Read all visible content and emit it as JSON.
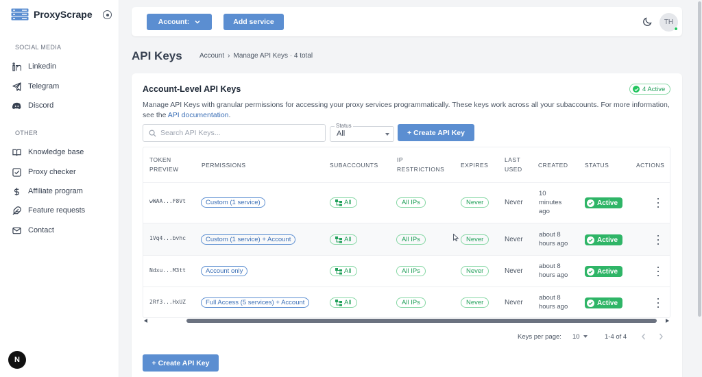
{
  "brand": {
    "name": "ProxyScrape",
    "logo_icon": "server-stack-icon",
    "accent": "#5b8ed1"
  },
  "sidebar": {
    "social_title": "SOCIAL MEDIA",
    "social": [
      {
        "label": "Linkedin",
        "icon": "linkedin-icon"
      },
      {
        "label": "Telegram",
        "icon": "telegram-icon"
      },
      {
        "label": "Discord",
        "icon": "discord-icon"
      }
    ],
    "other_title": "OTHER",
    "other": [
      {
        "label": "Knowledge base",
        "icon": "book-icon"
      },
      {
        "label": "Proxy checker",
        "icon": "checkbox-icon"
      },
      {
        "label": "Affiliate program",
        "icon": "dollar-icon"
      },
      {
        "label": "Feature requests",
        "icon": "feather-icon"
      },
      {
        "label": "Contact",
        "icon": "mail-icon"
      }
    ],
    "n_badge": "N"
  },
  "topbar": {
    "account_label": "Account:",
    "add_service_label": "Add service",
    "avatar_initials": "TH",
    "avatar_status_color": "#22c55e"
  },
  "header": {
    "title": "API Keys",
    "breadcrumb_root": "Account",
    "breadcrumb_current": "Manage API Keys · 4 total"
  },
  "card": {
    "title": "Account-Level API Keys",
    "active_badge": "4 Active",
    "description": "Manage API Keys with granular permissions for accessing your proxy services programmatically. These keys work across all your subaccounts. For more information, see the",
    "doc_link": "API documentation",
    "doc_suffix": ".",
    "search_placeholder": "Search API Keys...",
    "status_legend": "Status",
    "status_value": "All",
    "create_label": "+ Create API Key"
  },
  "table": {
    "headers": {
      "token": [
        "TOKEN",
        "PREVIEW"
      ],
      "permissions": "PERMISSIONS",
      "subaccounts": "SUBACCOUNTS",
      "ip": [
        "IP",
        "RESTRICTIONS"
      ],
      "expires": "EXPIRES",
      "last_used": [
        "LAST",
        "USED"
      ],
      "created": "CREATED",
      "status": "STATUS",
      "actions": "ACTIONS"
    },
    "rows": [
      {
        "token": "wWAA...F8Vt",
        "permissions": "Custom (1 service)",
        "subaccounts": "All",
        "ip": "All IPs",
        "expires": "Never",
        "last_used": "Never",
        "created": [
          "10",
          "minutes",
          "ago"
        ],
        "status": "Active"
      },
      {
        "token": "1Vq4...bvhc",
        "permissions": "Custom (1 service) + Account",
        "subaccounts": "All",
        "ip": "All IPs",
        "expires": "Never",
        "last_used": "Never",
        "created": [
          "about 8",
          "hours ago"
        ],
        "status": "Active"
      },
      {
        "token": "Ndxu...M3tt",
        "permissions": "Account only",
        "subaccounts": "All",
        "ip": "All IPs",
        "expires": "Never",
        "last_used": "Never",
        "created": [
          "about 8",
          "hours ago"
        ],
        "status": "Active"
      },
      {
        "token": "2Rf3...HxUZ",
        "permissions": "Full Access (5 services) + Account",
        "subaccounts": "All",
        "ip": "All IPs",
        "expires": "Never",
        "last_used": "Never",
        "created": [
          "about 8",
          "hours ago"
        ],
        "status": "Active"
      }
    ],
    "status_color": "#2fb567"
  },
  "pagination": {
    "keys_per_page_label": "Keys per page:",
    "keys_per_page_value": "10",
    "range": "1-4 of 4"
  },
  "bottom": {
    "create_label": "+ Create API Key"
  }
}
